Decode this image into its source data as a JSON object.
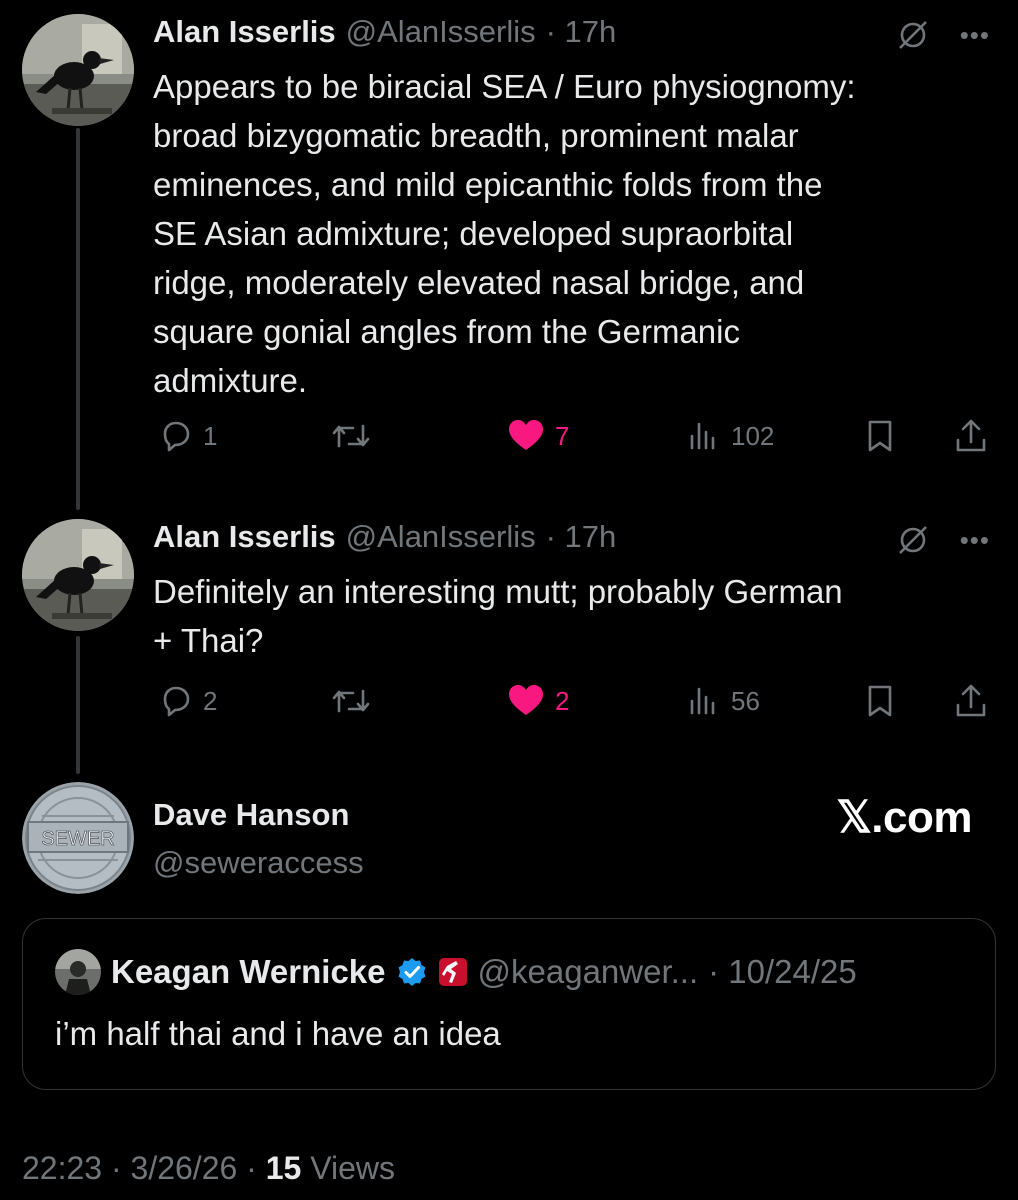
{
  "tweets": [
    {
      "author_name": "Alan Isserlis",
      "handle": "@AlanIsserlis",
      "time": "· 17h",
      "text_lines": [
        "Appears to be biracial SEA / Euro physiognomy:",
        "broad bizygomatic breadth, prominent malar",
        "eminences, and mild epicanthic folds from the",
        "SE Asian admixture; developed supraorbital",
        "ridge, moderately elevated nasal bridge, and",
        "square gonial angles from the Germanic",
        "admixture."
      ],
      "replies": "1",
      "likes": "7",
      "views": "102"
    },
    {
      "author_name": "Alan Isserlis",
      "handle": "@AlanIsserlis",
      "time": "· 17h",
      "text_lines": [
        "Definitely an interesting mutt; probably German",
        "+ Thai?"
      ],
      "replies": "2",
      "likes": "2",
      "views": "56"
    }
  ],
  "main": {
    "author_name": "Dave Hanson",
    "handle": "@seweraccess",
    "avatar_text": "SEWER",
    "watermark": "𝕏.com"
  },
  "quote": {
    "author_name": "Keagan Wernicke",
    "handle": "@keaganwer...",
    "date": "· 10/24/25",
    "text": "i’m half thai and i have an idea"
  },
  "footer": {
    "time": "22:23 · 3/26/26 · ",
    "views_count": "15",
    "views_label": " Views"
  },
  "colors": {
    "background": "#000000",
    "text": "#e7e9ea",
    "secondary": "#71767b",
    "like": "#f91880",
    "verified": "#1d9bf0"
  },
  "icons": [
    "reply-icon",
    "retweet-icon",
    "heart-icon",
    "views-icon",
    "bookmark-icon",
    "share-icon",
    "grok-icon",
    "more-icon",
    "verified-badge-icon"
  ]
}
